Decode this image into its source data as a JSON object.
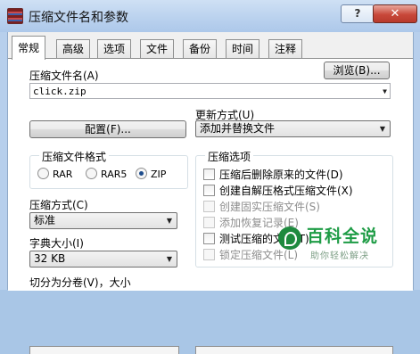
{
  "window": {
    "title": "压缩文件名和参数",
    "help_label": "?",
    "close_label": "✕"
  },
  "tabs": [
    "常规",
    "高级",
    "选项",
    "文件",
    "备份",
    "时间",
    "注释"
  ],
  "general": {
    "archive_name_label": "压缩文件名(A)",
    "archive_name_value": "click.zip",
    "browse_button": "浏览(B)...",
    "update_mode_label": "更新方式(U)",
    "update_mode_value": "添加并替换文件",
    "profiles_button": "配置(F)...",
    "archive_format": {
      "title": "压缩文件格式",
      "options": [
        "RAR",
        "RAR5",
        "ZIP"
      ],
      "selected": "ZIP"
    },
    "compression_method_label": "压缩方式(C)",
    "compression_method_value": "标准",
    "dictionary_size_label": "字典大小(I)",
    "dictionary_size_value": "32 KB",
    "split_label": "切分为分卷(V)，大小",
    "archive_options": {
      "title": "压缩选项",
      "items": [
        {
          "label": "压缩后删除原来的文件(D)",
          "enabled": true,
          "checked": false
        },
        {
          "label": "创建自解压格式压缩文件(X)",
          "enabled": true,
          "checked": false
        },
        {
          "label": "创建固实压缩文件(S)",
          "enabled": false,
          "checked": false
        },
        {
          "label": "添加恢复记录(E)",
          "enabled": false,
          "checked": false
        },
        {
          "label": "测试压缩的文件(T)",
          "enabled": true,
          "checked": false
        },
        {
          "label": "锁定压缩文件(L)",
          "enabled": false,
          "checked": false
        }
      ]
    }
  },
  "watermark": {
    "title": "百科全说",
    "subtitle": "助你轻松解决"
  }
}
